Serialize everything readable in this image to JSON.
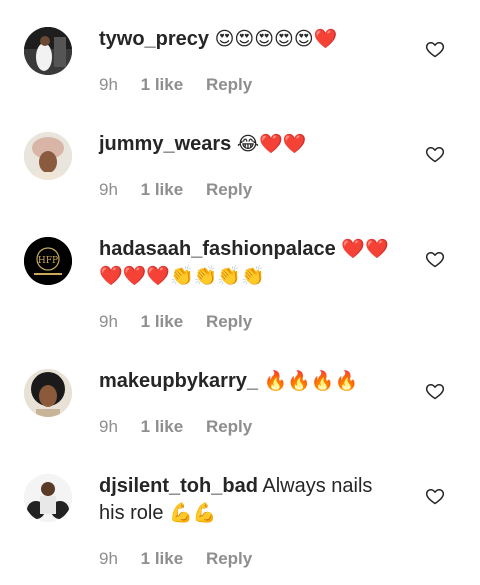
{
  "comments": [
    {
      "username": "tywo_precy",
      "text": "",
      "emoji": "😍😍😍😍😍❤️",
      "time": "9h",
      "likes": "1 like",
      "reply": "Reply"
    },
    {
      "username": "jummy_wears",
      "text": "",
      "emoji": "😂❤️❤️",
      "time": "9h",
      "likes": "1 like",
      "reply": "Reply"
    },
    {
      "username": "hadasaah_fashionpalace",
      "text": "",
      "emoji": "❤️❤️",
      "emoji2": "❤️❤️❤️👏👏👏👏",
      "avatar_text": "HFP",
      "time": "9h",
      "likes": "1 like",
      "reply": "Reply"
    },
    {
      "username": "makeupbykarry_",
      "text": "",
      "emoji": "🔥🔥🔥🔥",
      "time": "9h",
      "likes": "1 like",
      "reply": "Reply"
    },
    {
      "username": "djsilent_toh_bad",
      "text": "Always nails",
      "text2": "his role",
      "emoji": "💪💪",
      "time": "9h",
      "likes": "1 like",
      "reply": "Reply"
    }
  ],
  "icons": {
    "like": "heart-outline-icon"
  },
  "colors": {
    "text": "#262626",
    "meta": "#8e8e8e",
    "background": "#ffffff"
  }
}
